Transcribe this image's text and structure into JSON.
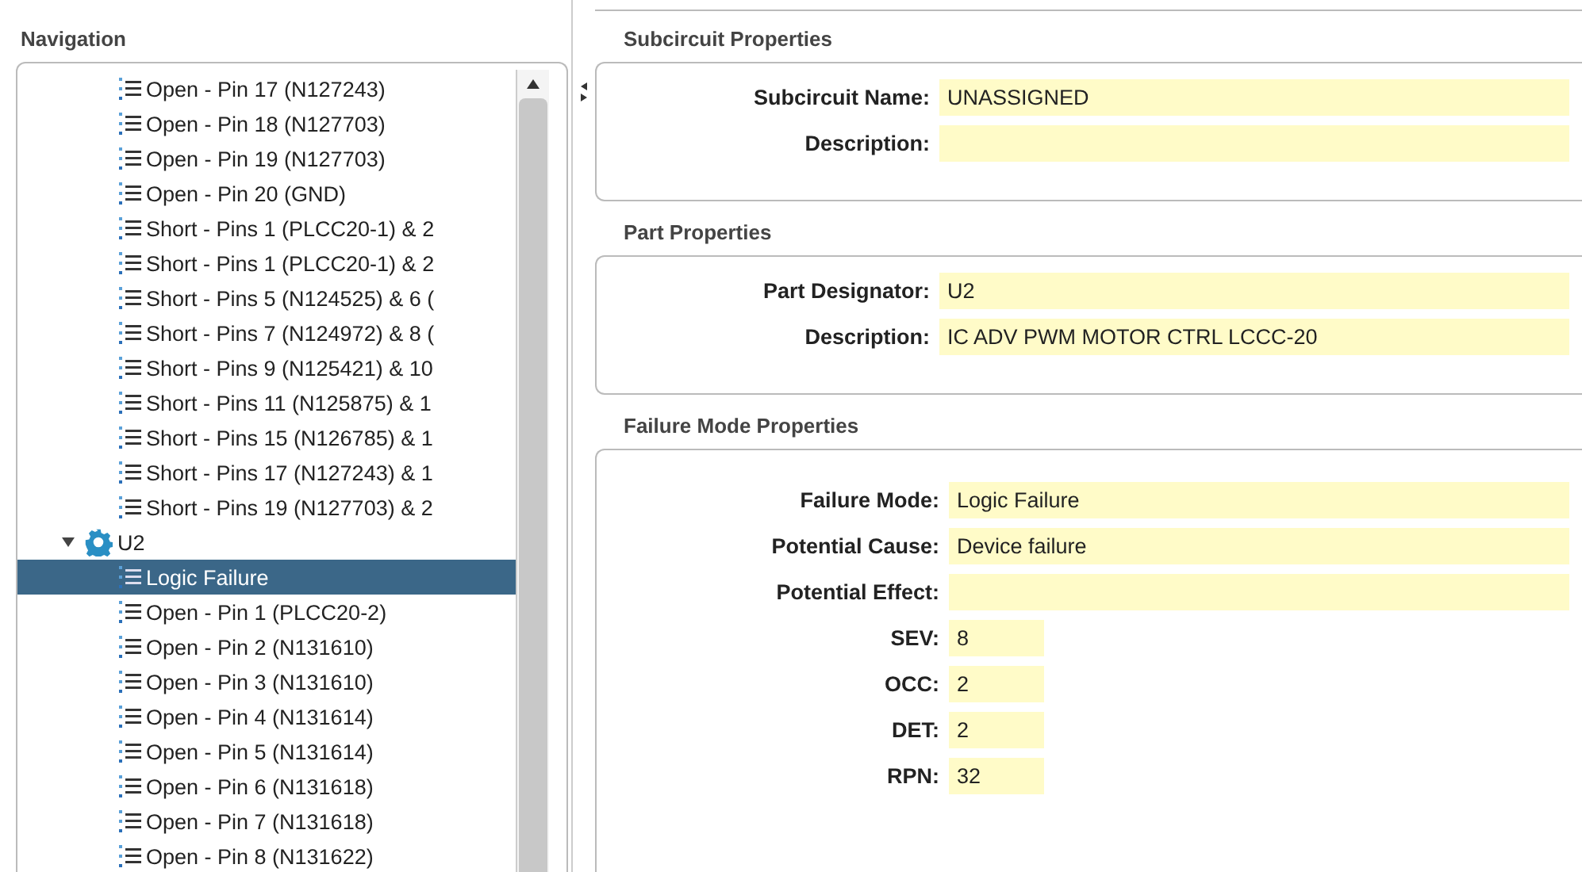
{
  "navigation": {
    "title": "Navigation",
    "tree": [
      {
        "children": [
          {
            "label": "Open - Pin 17 (N127243)",
            "selected": false
          },
          {
            "label": "Open - Pin 18 (N127703)",
            "selected": false
          },
          {
            "label": "Open - Pin 19 (N127703)",
            "selected": false
          },
          {
            "label": "Open - Pin 20 (GND)",
            "selected": false
          },
          {
            "label": "Short - Pins 1 (PLCC20-1) & 2",
            "selected": false
          },
          {
            "label": "Short - Pins 1 (PLCC20-1) & 2",
            "selected": false
          },
          {
            "label": "Short - Pins 5 (N124525) & 6 (",
            "selected": false
          },
          {
            "label": "Short - Pins 7 (N124972) & 8 (",
            "selected": false
          },
          {
            "label": "Short - Pins 9 (N125421) & 10",
            "selected": false
          },
          {
            "label": "Short - Pins 11 (N125875) & 1",
            "selected": false
          },
          {
            "label": "Short - Pins 15 (N126785) & 1",
            "selected": false
          },
          {
            "label": "Short - Pins 17 (N127243) & 1",
            "selected": false
          },
          {
            "label": "Short - Pins 19 (N127703) & 2",
            "selected": false
          }
        ]
      },
      {
        "label": "U2",
        "expanded": true,
        "children": [
          {
            "label": "Logic Failure",
            "selected": true
          },
          {
            "label": "Open - Pin 1 (PLCC20-2)",
            "selected": false
          },
          {
            "label": "Open - Pin 2 (N131610)",
            "selected": false
          },
          {
            "label": "Open - Pin 3 (N131610)",
            "selected": false
          },
          {
            "label": "Open - Pin 4 (N131614)",
            "selected": false
          },
          {
            "label": "Open - Pin 5 (N131614)",
            "selected": false
          },
          {
            "label": "Open - Pin 6 (N131618)",
            "selected": false
          },
          {
            "label": "Open - Pin 7 (N131618)",
            "selected": false
          },
          {
            "label": "Open - Pin 8 (N131622)",
            "selected": false
          }
        ]
      }
    ]
  },
  "sections": [
    {
      "title": "Subcircuit Properties",
      "fields": [
        {
          "label": "Subcircuit Name:",
          "value": "UNASSIGNED",
          "kind": "wide"
        },
        {
          "label": "Description:",
          "kind": "wide"
        }
      ]
    },
    {
      "title": "Part Properties",
      "fields": [
        {
          "label": "Part Designator:",
          "value": "U2",
          "kind": "wide"
        },
        {
          "label": "Description:",
          "value": "IC ADV PWM MOTOR CTRL LCCC-20",
          "kind": "wide"
        }
      ]
    },
    {
      "title": "Failure Mode Properties",
      "fields": [
        {
          "label": "Failure Mode:",
          "value": "Logic Failure",
          "kind": "wide"
        },
        {
          "label": "Potential Cause:",
          "value": "Device failure",
          "kind": "wide"
        },
        {
          "label": "Potential Effect:",
          "kind": "wide"
        },
        {
          "label": "SEV:",
          "value": "8",
          "kind": "short"
        },
        {
          "label": "OCC:",
          "value": "2",
          "kind": "short"
        },
        {
          "label": "DET:",
          "value": "2",
          "kind": "short"
        },
        {
          "label": "RPN:",
          "value": "32",
          "kind": "short"
        }
      ]
    }
  ]
}
